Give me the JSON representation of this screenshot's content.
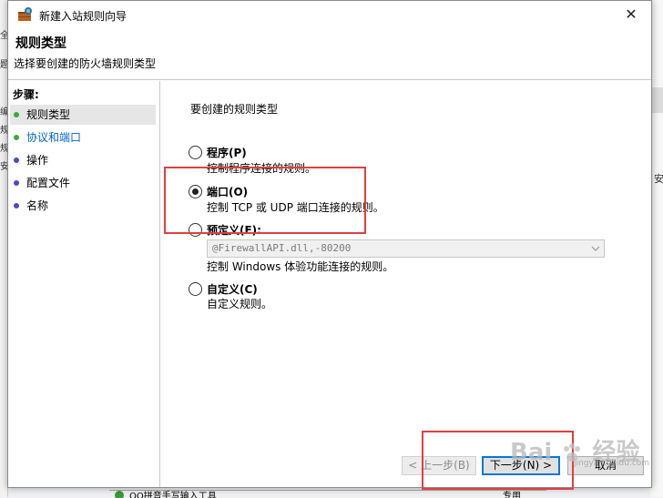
{
  "window": {
    "title": "新建入站规则向导",
    "close_glyph": "✕"
  },
  "header": {
    "title": "规则类型",
    "subtitle": "选择要创建的防火墙规则类型"
  },
  "steps": {
    "label": "步骤:",
    "items": [
      {
        "label": "规则类型",
        "dot_color": "#3aaa3a",
        "active": true
      },
      {
        "label": "协议和端口",
        "dot_color": "#3aaa3a",
        "link": true
      },
      {
        "label": "操作",
        "dot_color": "#4a4acc"
      },
      {
        "label": "配置文件",
        "dot_color": "#4a4acc"
      },
      {
        "label": "名称",
        "dot_color": "#4a4acc"
      }
    ]
  },
  "content": {
    "prompt": "要创建的规则类型",
    "options": [
      {
        "title": "程序(P)",
        "desc": "控制程序连接的规则。",
        "checked": false
      },
      {
        "title": "端口(O)",
        "desc": "控制 TCP 或 UDP 端口连接的规则。",
        "checked": true
      },
      {
        "title": "预定义(E):",
        "desc": "控制 Windows 体验功能连接的规则。",
        "checked": false
      },
      {
        "title": "自定义(C)",
        "desc": "自定义规则。",
        "checked": false
      }
    ],
    "predefined_select": {
      "value": "@FirewallAPI.dll,-80200",
      "disabled": true
    }
  },
  "buttons": {
    "back": "< 上一步(B)",
    "next": "下一步(N) >",
    "cancel": "取消"
  },
  "background": {
    "left_fragments": [
      "全",
      "题",
      "编",
      "规",
      "规",
      "安"
    ],
    "right_fragment": "安",
    "bottom_item": "QQ拼音手写输入工具",
    "bottom_status": "专用"
  },
  "watermark": {
    "text": "Bai",
    "text2": "经验",
    "sub": "jingyan.baidu.com"
  },
  "colors": {
    "accent": "#0078d7",
    "annotation": "#e04040",
    "link": "#0066cc"
  }
}
